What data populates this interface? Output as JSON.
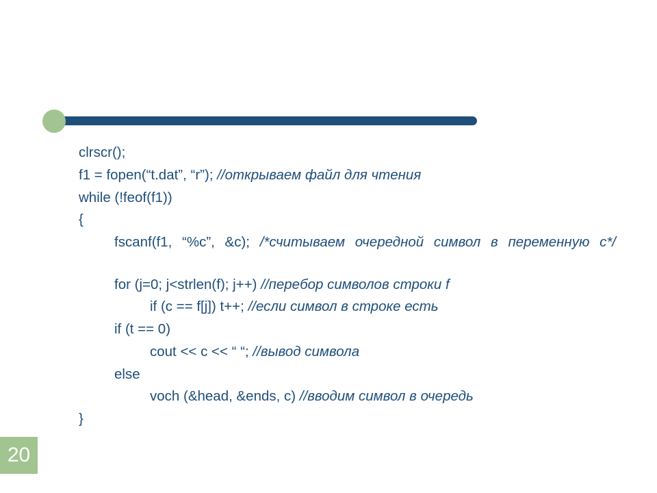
{
  "colors": {
    "accent": "#1f4e79",
    "green": "#a1c490"
  },
  "page_number": "20",
  "lines": {
    "l0": "clrscr();",
    "l1_a": "f1 = fopen(“t.dat”, “r”); ",
    "l1_b": "//открываем файл для чтения",
    "l2": "while (!feof(f1))",
    "l3": "{",
    "l4_a": "fscanf(f1, “%c”, &c); ",
    "l4_b": "/*считываем очередной символ в переменную c*/",
    "l5_a": "for (j=0; j<strlen(f); j++) ",
    "l5_b": "//перебор символов строки f",
    "l6_a": "if (c == f[j]) t++; ",
    "l6_b": "//если символ в строке есть",
    "l7": "if (t == 0)",
    "l8_a": "cout << c << “ “; ",
    "l8_b": "//вывод символа",
    "l9": "else",
    "l10_a": "voch (&head, &ends, c) ",
    "l10_b": "//вводим символ в очередь",
    "l11": "}"
  }
}
